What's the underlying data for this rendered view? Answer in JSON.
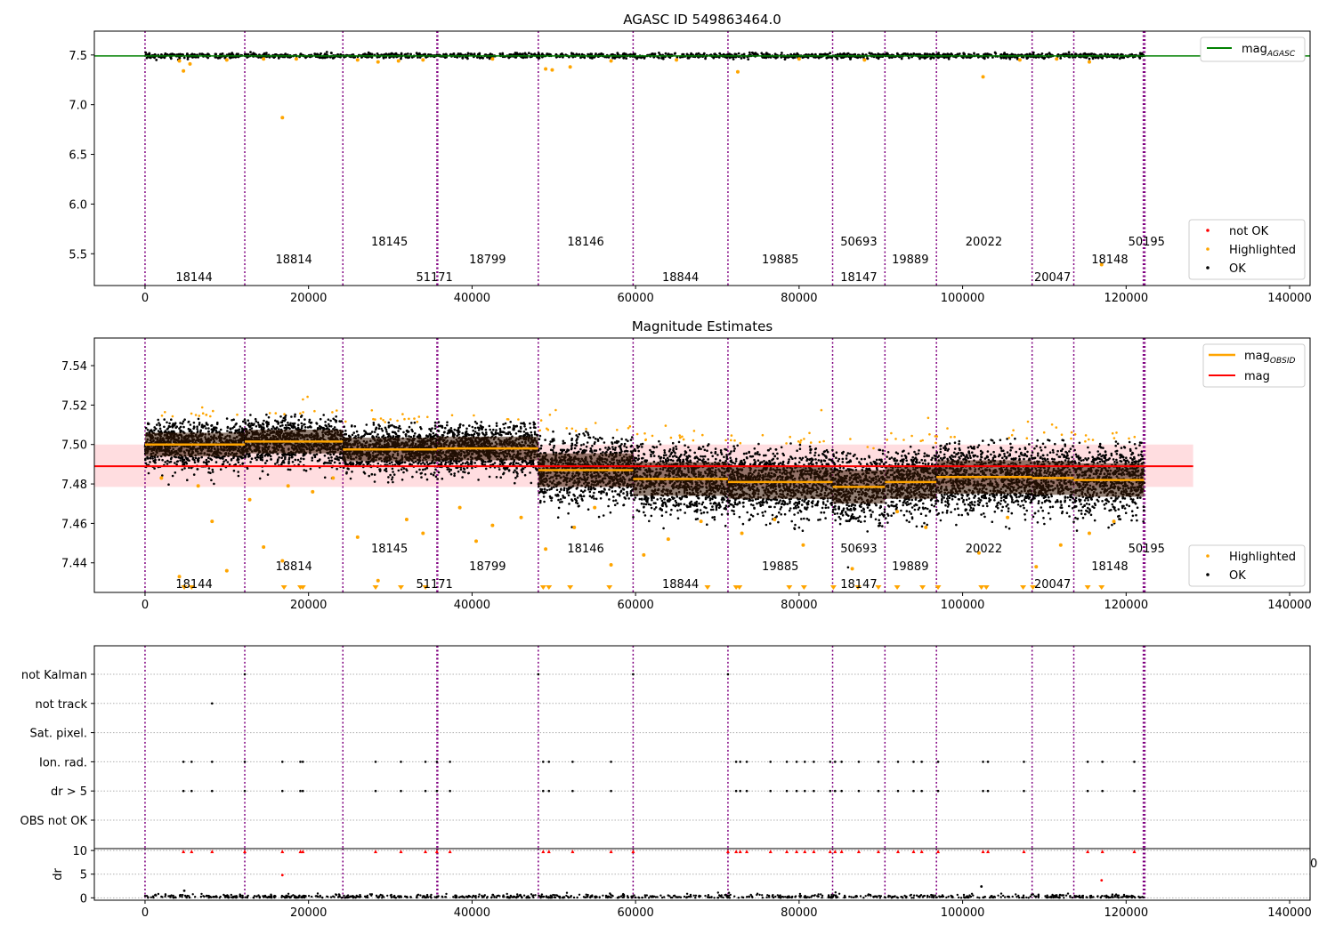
{
  "figure_title": "AGASC ID 549863464.0",
  "colors": {
    "ok": "#000000",
    "highlighted": "#ffa500",
    "not_ok": "#ff0000",
    "obsid_line": "#800080",
    "mag_agasc_line": "#008000",
    "mag_line": "#ff0000",
    "mag_obsid_line": "#ffa500",
    "band_fill": "#ffdde0",
    "dr_flag": "#ff0000"
  },
  "chart_data": [
    {
      "id": "agasc",
      "type": "scatter",
      "title": "AGASC ID 549863464.0",
      "xlim": [
        -6200,
        142500
      ],
      "ylim": [
        5.18,
        7.74
      ],
      "xticks": [
        0,
        20000,
        40000,
        60000,
        80000,
        100000,
        120000,
        140000
      ],
      "xtick_labels": [
        "0",
        "20000",
        "40000",
        "60000",
        "80000",
        "100000",
        "120000",
        "140000"
      ],
      "yticks": [
        5.5,
        6.0,
        6.5,
        7.0,
        7.5
      ],
      "ytick_labels": [
        "5.5",
        "6.0",
        "6.5",
        "7.0",
        "7.5"
      ],
      "mag_agasc": 7.49,
      "legend_top": [
        {
          "label_main": "mag",
          "label_sub": "AGASC",
          "color": "#008000",
          "marker": "line"
        }
      ],
      "legend_bottom": [
        {
          "label": "not OK",
          "color": "#ff0000",
          "marker": "dot"
        },
        {
          "label": "Highlighted",
          "color": "#ffa500",
          "marker": "dot"
        },
        {
          "label": "OK",
          "color": "#000000",
          "marker": "dot"
        }
      ],
      "legend_top_placement": "upper right",
      "legend_bottom_placement": "lower right",
      "highlighted_points": [
        {
          "x": 4200,
          "y": 7.44
        },
        {
          "x": 4700,
          "y": 7.34
        },
        {
          "x": 5500,
          "y": 7.41
        },
        {
          "x": 10000,
          "y": 7.45
        },
        {
          "x": 14500,
          "y": 7.46
        },
        {
          "x": 16800,
          "y": 6.87
        },
        {
          "x": 18500,
          "y": 7.46
        },
        {
          "x": 26000,
          "y": 7.45
        },
        {
          "x": 28500,
          "y": 7.43
        },
        {
          "x": 31000,
          "y": 7.44
        },
        {
          "x": 34000,
          "y": 7.45
        },
        {
          "x": 42500,
          "y": 7.46
        },
        {
          "x": 49000,
          "y": 7.36
        },
        {
          "x": 49800,
          "y": 7.35
        },
        {
          "x": 52000,
          "y": 7.38
        },
        {
          "x": 57000,
          "y": 7.44
        },
        {
          "x": 65000,
          "y": 7.45
        },
        {
          "x": 72500,
          "y": 7.33
        },
        {
          "x": 80000,
          "y": 7.46
        },
        {
          "x": 88000,
          "y": 7.45
        },
        {
          "x": 102500,
          "y": 7.28
        },
        {
          "x": 107000,
          "y": 7.45
        },
        {
          "x": 111500,
          "y": 7.46
        },
        {
          "x": 115500,
          "y": 7.43
        },
        {
          "x": 117000,
          "y": 5.39
        }
      ]
    },
    {
      "id": "magnitude",
      "type": "scatter",
      "title": "Magnitude Estimates",
      "xlim": [
        -6200,
        142500
      ],
      "ylim": [
        7.425,
        7.554
      ],
      "xticks": [
        0,
        20000,
        40000,
        60000,
        80000,
        100000,
        120000,
        140000
      ],
      "xtick_labels": [
        "0",
        "20000",
        "40000",
        "60000",
        "80000",
        "100000",
        "120000",
        "140000"
      ],
      "yticks": [
        7.44,
        7.46,
        7.48,
        7.5,
        7.52,
        7.54
      ],
      "ytick_labels": [
        "7.44",
        "7.46",
        "7.48",
        "7.50",
        "7.52",
        "7.54"
      ],
      "mag": 7.489,
      "mag_band": [
        7.4785,
        7.5
      ],
      "mag_band_x": [
        -6200,
        128200
      ],
      "segments": [
        {
          "x0": 0,
          "x1": 12200,
          "mag": 7.5
        },
        {
          "x0": 12200,
          "x1": 24200,
          "mag": 7.5015
        },
        {
          "x0": 24200,
          "x1": 35700,
          "mag": 7.4975
        },
        {
          "x0": 35700,
          "x1": 48100,
          "mag": 7.498
        },
        {
          "x0": 48100,
          "x1": 59700,
          "mag": 7.487
        },
        {
          "x0": 59700,
          "x1": 71300,
          "mag": 7.4825
        },
        {
          "x0": 71300,
          "x1": 84100,
          "mag": 7.481
        },
        {
          "x0": 84100,
          "x1": 90500,
          "mag": 7.4785
        },
        {
          "x0": 90500,
          "x1": 96800,
          "mag": 7.481
        },
        {
          "x0": 96800,
          "x1": 108500,
          "mag": 7.4835
        },
        {
          "x0": 108500,
          "x1": 113600,
          "mag": 7.483
        },
        {
          "x0": 113600,
          "x1": 122200,
          "mag": 7.482
        }
      ],
      "legend_top": [
        {
          "label_main": "mag",
          "label_sub": "OBSID",
          "color": "#ffa500",
          "marker": "line"
        },
        {
          "label_main": "mag",
          "label_sub": "",
          "color": "#ff0000",
          "marker": "line"
        }
      ],
      "legend_bottom": [
        {
          "label": "Highlighted",
          "color": "#ffa500",
          "marker": "dot"
        },
        {
          "label": "OK",
          "color": "#000000",
          "marker": "dot"
        }
      ],
      "legend_top_placement": "upper right",
      "legend_bottom_placement": "lower right",
      "highlighted_points": [
        {
          "x": 2000,
          "y": 7.483
        },
        {
          "x": 4200,
          "y": 7.433
        },
        {
          "x": 6500,
          "y": 7.479
        },
        {
          "x": 8200,
          "y": 7.461
        },
        {
          "x": 10000,
          "y": 7.436
        },
        {
          "x": 12800,
          "y": 7.472
        },
        {
          "x": 14500,
          "y": 7.448
        },
        {
          "x": 16800,
          "y": 7.441
        },
        {
          "x": 17500,
          "y": 7.479
        },
        {
          "x": 20500,
          "y": 7.476
        },
        {
          "x": 23000,
          "y": 7.483
        },
        {
          "x": 26000,
          "y": 7.453
        },
        {
          "x": 28500,
          "y": 7.431
        },
        {
          "x": 32000,
          "y": 7.462
        },
        {
          "x": 34000,
          "y": 7.455
        },
        {
          "x": 38500,
          "y": 7.468
        },
        {
          "x": 40500,
          "y": 7.451
        },
        {
          "x": 42500,
          "y": 7.459
        },
        {
          "x": 46000,
          "y": 7.463
        },
        {
          "x": 49000,
          "y": 7.447
        },
        {
          "x": 52500,
          "y": 7.458
        },
        {
          "x": 55000,
          "y": 7.468
        },
        {
          "x": 57000,
          "y": 7.439
        },
        {
          "x": 61000,
          "y": 7.444
        },
        {
          "x": 64000,
          "y": 7.452
        },
        {
          "x": 68000,
          "y": 7.461
        },
        {
          "x": 73000,
          "y": 7.455
        },
        {
          "x": 77000,
          "y": 7.462
        },
        {
          "x": 80500,
          "y": 7.449
        },
        {
          "x": 86500,
          "y": 7.437
        },
        {
          "x": 92000,
          "y": 7.466
        },
        {
          "x": 95500,
          "y": 7.458
        },
        {
          "x": 102000,
          "y": 7.445
        },
        {
          "x": 105500,
          "y": 7.463
        },
        {
          "x": 109000,
          "y": 7.438
        },
        {
          "x": 112000,
          "y": 7.449
        },
        {
          "x": 115500,
          "y": 7.455
        },
        {
          "x": 118500,
          "y": 7.461
        }
      ],
      "off_scale_low_x": [
        4800,
        5700,
        17000,
        19000,
        19300,
        28200,
        31300,
        34300,
        48700,
        49400,
        52000,
        56800,
        68800,
        72300,
        72700,
        78800,
        80600,
        84200,
        87200,
        89700,
        92000,
        95100,
        97000,
        102300,
        102900,
        107400,
        108600,
        115300,
        117000
      ]
    },
    {
      "id": "flags",
      "type": "scatter",
      "title": "",
      "xlim": [
        -6200,
        142500
      ],
      "flag_rows": [
        "not Kalman",
        "not track",
        "Sat. pixel.",
        "Ion. rad.",
        "dr > 5",
        "OBS not OK"
      ],
      "flag_points": [
        {
          "row": "not Kalman",
          "x": [
            12200,
            48100,
            59700,
            71300
          ]
        },
        {
          "row": "not track",
          "x": [
            8200
          ]
        },
        {
          "row": "Sat. pixel.",
          "x": []
        },
        {
          "row": "Ion. rad.",
          "x": [
            4700,
            5700,
            8200,
            12200,
            16800,
            19000,
            19300,
            28200,
            31300,
            34300,
            35700,
            37300,
            48700,
            49400,
            52300,
            57000,
            72300,
            72800,
            73600,
            76500,
            78500,
            79700,
            80700,
            81800,
            83800,
            84400,
            85200,
            87300,
            89700,
            92100,
            94000,
            95000,
            97000,
            102500,
            103100,
            107500,
            115300,
            117100,
            121000
          ]
        },
        {
          "row": "dr > 5",
          "x": [
            4700,
            5700,
            8200,
            12200,
            16800,
            19000,
            19300,
            28200,
            31300,
            34300,
            35700,
            37300,
            48700,
            49400,
            52300,
            57000,
            72300,
            72800,
            73600,
            76500,
            78500,
            79700,
            80700,
            81800,
            83800,
            84400,
            85200,
            87300,
            89700,
            92100,
            94000,
            95000,
            97000,
            102500,
            103100,
            107500,
            115300,
            117100,
            121000
          ]
        },
        {
          "row": "OBS not OK",
          "x": []
        }
      ]
    },
    {
      "id": "dr",
      "type": "scatter",
      "title": "",
      "xlim": [
        -6200,
        142500
      ],
      "ylim": [
        -0.5,
        10.4
      ],
      "ylabel": "dr",
      "yticks": [
        0,
        5,
        10
      ],
      "ytick_labels": [
        "0",
        "5",
        "10"
      ],
      "xticks": [
        0,
        20000,
        40000,
        60000,
        80000,
        100000,
        120000,
        140000
      ],
      "xtick_labels": [
        "0",
        "20000",
        "40000",
        "60000",
        "80000",
        "100000",
        "120000",
        "140000"
      ],
      "edge_label": "0",
      "flag_10_x": [
        4700,
        5700,
        8200,
        12200,
        16800,
        19000,
        19300,
        28200,
        31300,
        34300,
        35700,
        37300,
        48700,
        49400,
        52300,
        57000,
        59700,
        71300,
        72300,
        72800,
        73600,
        76500,
        78500,
        79700,
        80700,
        81800,
        83800,
        84400,
        85200,
        87300,
        89700,
        92100,
        94000,
        95000,
        97000,
        102500,
        103100,
        107500,
        115300,
        117100,
        121000
      ],
      "extra_points": [
        {
          "x": 16800,
          "y": 4.8,
          "color": "#ff0000"
        },
        {
          "x": 117000,
          "y": 3.7,
          "color": "#ff0000"
        },
        {
          "x": 102300,
          "y": 2.4,
          "color": "#000000"
        },
        {
          "x": 4800,
          "y": 1.5,
          "color": "#000000"
        }
      ]
    }
  ],
  "obsids": [
    {
      "x": 0,
      "label": "18144",
      "level": 0
    },
    {
      "x": 12200,
      "label": "18814",
      "level": 1
    },
    {
      "x": 24200,
      "label": "18145",
      "level": 2
    },
    {
      "x": 35700,
      "label": "51171",
      "level": 0
    },
    {
      "x": 35800,
      "label": "",
      "level": 0
    },
    {
      "x": 48100,
      "label": "18799",
      "level": 1
    },
    {
      "x": 59700,
      "label": "18146",
      "level": 2
    },
    {
      "x": 71300,
      "label": "18844",
      "level": 0
    },
    {
      "x": 84100,
      "label": "19885",
      "level": 1
    },
    {
      "x": 90500,
      "label": "50693",
      "level": 2
    },
    {
      "x": 96800,
      "label": "18147",
      "level": 0
    },
    {
      "x": 108500,
      "label": "19889",
      "level": 1
    },
    {
      "x": 113600,
      "label": "20022",
      "level": 2
    },
    {
      "x": 122100,
      "label": "20047",
      "level": 0
    },
    {
      "x": 122200,
      "label": "18148",
      "level": 1
    },
    {
      "x": 122300,
      "label": "50195",
      "level": 2
    }
  ],
  "obsid_label_positions": [
    {
      "label": "18144",
      "x": 6000,
      "level": 0
    },
    {
      "label": "18814",
      "x": 18200,
      "level": 1
    },
    {
      "label": "18145",
      "x": 29900,
      "level": 2
    },
    {
      "label": "51171",
      "x": 35400,
      "level": 0
    },
    {
      "label": "18799",
      "x": 41900,
      "level": 1
    },
    {
      "label": "18146",
      "x": 53900,
      "level": 2
    },
    {
      "label": "18844",
      "x": 65500,
      "level": 0
    },
    {
      "label": "19885",
      "x": 77700,
      "level": 1
    },
    {
      "label": "50693",
      "x": 87300,
      "level": 2
    },
    {
      "label": "18147",
      "x": 87300,
      "level": 0
    },
    {
      "label": "19889",
      "x": 93600,
      "level": 1
    },
    {
      "label": "20022",
      "x": 102600,
      "level": 2
    },
    {
      "label": "20047",
      "x": 111000,
      "level": 0
    },
    {
      "label": "18148",
      "x": 118000,
      "level": 1
    },
    {
      "label": "50195",
      "x": 122500,
      "level": 2
    }
  ]
}
